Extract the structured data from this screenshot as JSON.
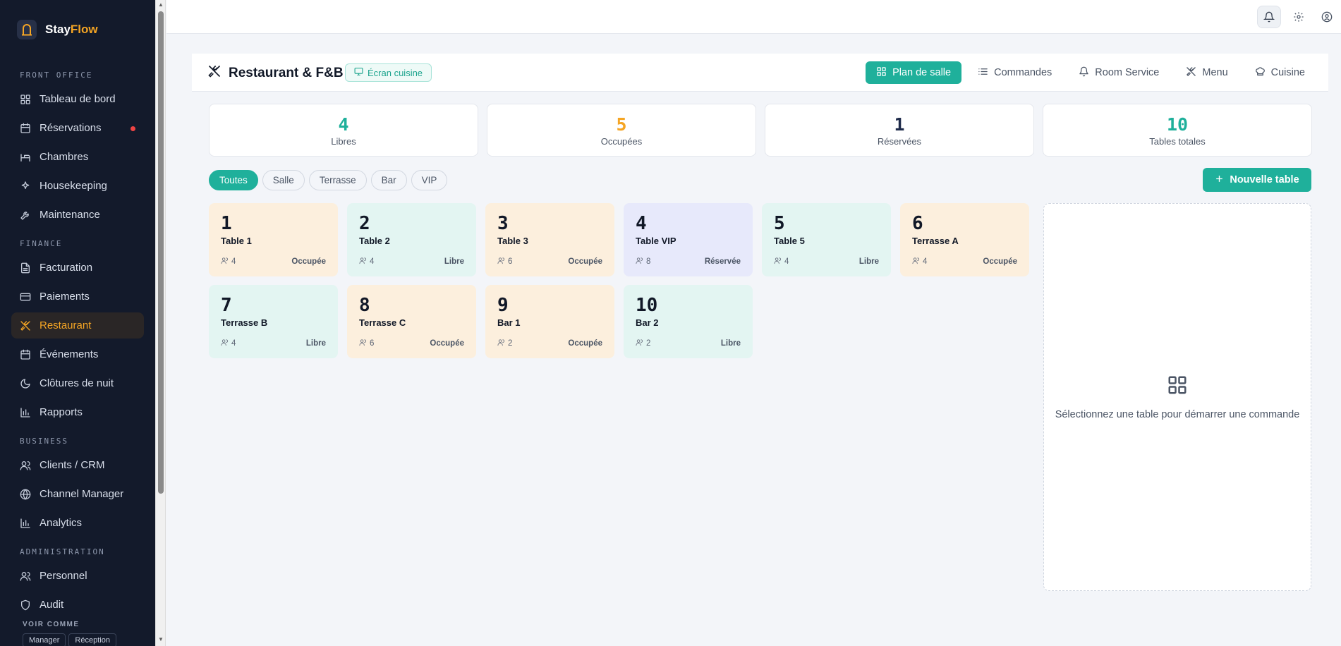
{
  "brand": {
    "name_part1": "Stay",
    "name_part2": "Flow"
  },
  "sidebar": {
    "sections": [
      {
        "title": "FRONT OFFICE",
        "items": [
          {
            "label": "Tableau de bord",
            "icon": "dashboard-icon"
          },
          {
            "label": "Réservations",
            "icon": "calendar-icon",
            "dot": true
          },
          {
            "label": "Chambres",
            "icon": "bed-icon"
          },
          {
            "label": "Housekeeping",
            "icon": "sparkles-icon"
          },
          {
            "label": "Maintenance",
            "icon": "wrench-icon"
          }
        ]
      },
      {
        "title": "FINANCE",
        "items": [
          {
            "label": "Facturation",
            "icon": "file-icon"
          },
          {
            "label": "Paiements",
            "icon": "card-icon"
          },
          {
            "label": "Restaurant",
            "icon": "utensils-icon",
            "active": true
          },
          {
            "label": "Événements",
            "icon": "calendar-icon"
          },
          {
            "label": "Clôtures de nuit",
            "icon": "moon-icon"
          },
          {
            "label": "Rapports",
            "icon": "bar-chart-icon"
          }
        ]
      },
      {
        "title": "BUSINESS",
        "items": [
          {
            "label": "Clients / CRM",
            "icon": "users-icon"
          },
          {
            "label": "Channel Manager",
            "icon": "globe-icon"
          },
          {
            "label": "Analytics",
            "icon": "bar-chart-icon"
          }
        ]
      },
      {
        "title": "ADMINISTRATION",
        "items": [
          {
            "label": "Personnel",
            "icon": "users-icon"
          },
          {
            "label": "Audit",
            "icon": "shield-icon"
          }
        ]
      }
    ],
    "voir_comme": "VOIR COMME",
    "roles": [
      "Manager",
      "Réception"
    ]
  },
  "header": {
    "title": "Restaurant & F&B",
    "kitchen_badge": "Écran cuisine",
    "tabs": [
      {
        "label": "Plan de salle",
        "icon": "grid-icon",
        "active": true
      },
      {
        "label": "Commandes",
        "icon": "list-icon"
      },
      {
        "label": "Room Service",
        "icon": "bell-icon"
      },
      {
        "label": "Menu",
        "icon": "utensils-icon"
      },
      {
        "label": "Cuisine",
        "icon": "chef-hat-icon"
      }
    ]
  },
  "stats": [
    {
      "value": "4",
      "label": "Libres",
      "color": "#1fb09b"
    },
    {
      "value": "5",
      "label": "Occupées",
      "color": "#f5a524"
    },
    {
      "value": "1",
      "label": "Réservées",
      "color": "#1e2a4a"
    },
    {
      "value": "10",
      "label": "Tables totales",
      "color": "#1fb09b"
    }
  ],
  "filters": [
    "Toutes",
    "Salle",
    "Terrasse",
    "Bar",
    "VIP"
  ],
  "new_table_label": "Nouvelle table",
  "tables": [
    {
      "num": "1",
      "name": "Table 1",
      "capacity": "4",
      "status": "Occupée",
      "kind": "occ"
    },
    {
      "num": "2",
      "name": "Table 2",
      "capacity": "4",
      "status": "Libre",
      "kind": "free"
    },
    {
      "num": "3",
      "name": "Table 3",
      "capacity": "6",
      "status": "Occupée",
      "kind": "occ"
    },
    {
      "num": "4",
      "name": "Table VIP",
      "capacity": "8",
      "status": "Réservée",
      "kind": "res"
    },
    {
      "num": "5",
      "name": "Table 5",
      "capacity": "4",
      "status": "Libre",
      "kind": "free"
    },
    {
      "num": "6",
      "name": "Terrasse A",
      "capacity": "4",
      "status": "Occupée",
      "kind": "occ"
    },
    {
      "num": "7",
      "name": "Terrasse B",
      "capacity": "4",
      "status": "Libre",
      "kind": "free"
    },
    {
      "num": "8",
      "name": "Terrasse C",
      "capacity": "6",
      "status": "Occupée",
      "kind": "occ"
    },
    {
      "num": "9",
      "name": "Bar 1",
      "capacity": "2",
      "status": "Occupée",
      "kind": "occ"
    },
    {
      "num": "10",
      "name": "Bar 2",
      "capacity": "2",
      "status": "Libre",
      "kind": "free"
    }
  ],
  "order_panel": {
    "message": "Sélectionnez une table pour démarrer une commande"
  }
}
